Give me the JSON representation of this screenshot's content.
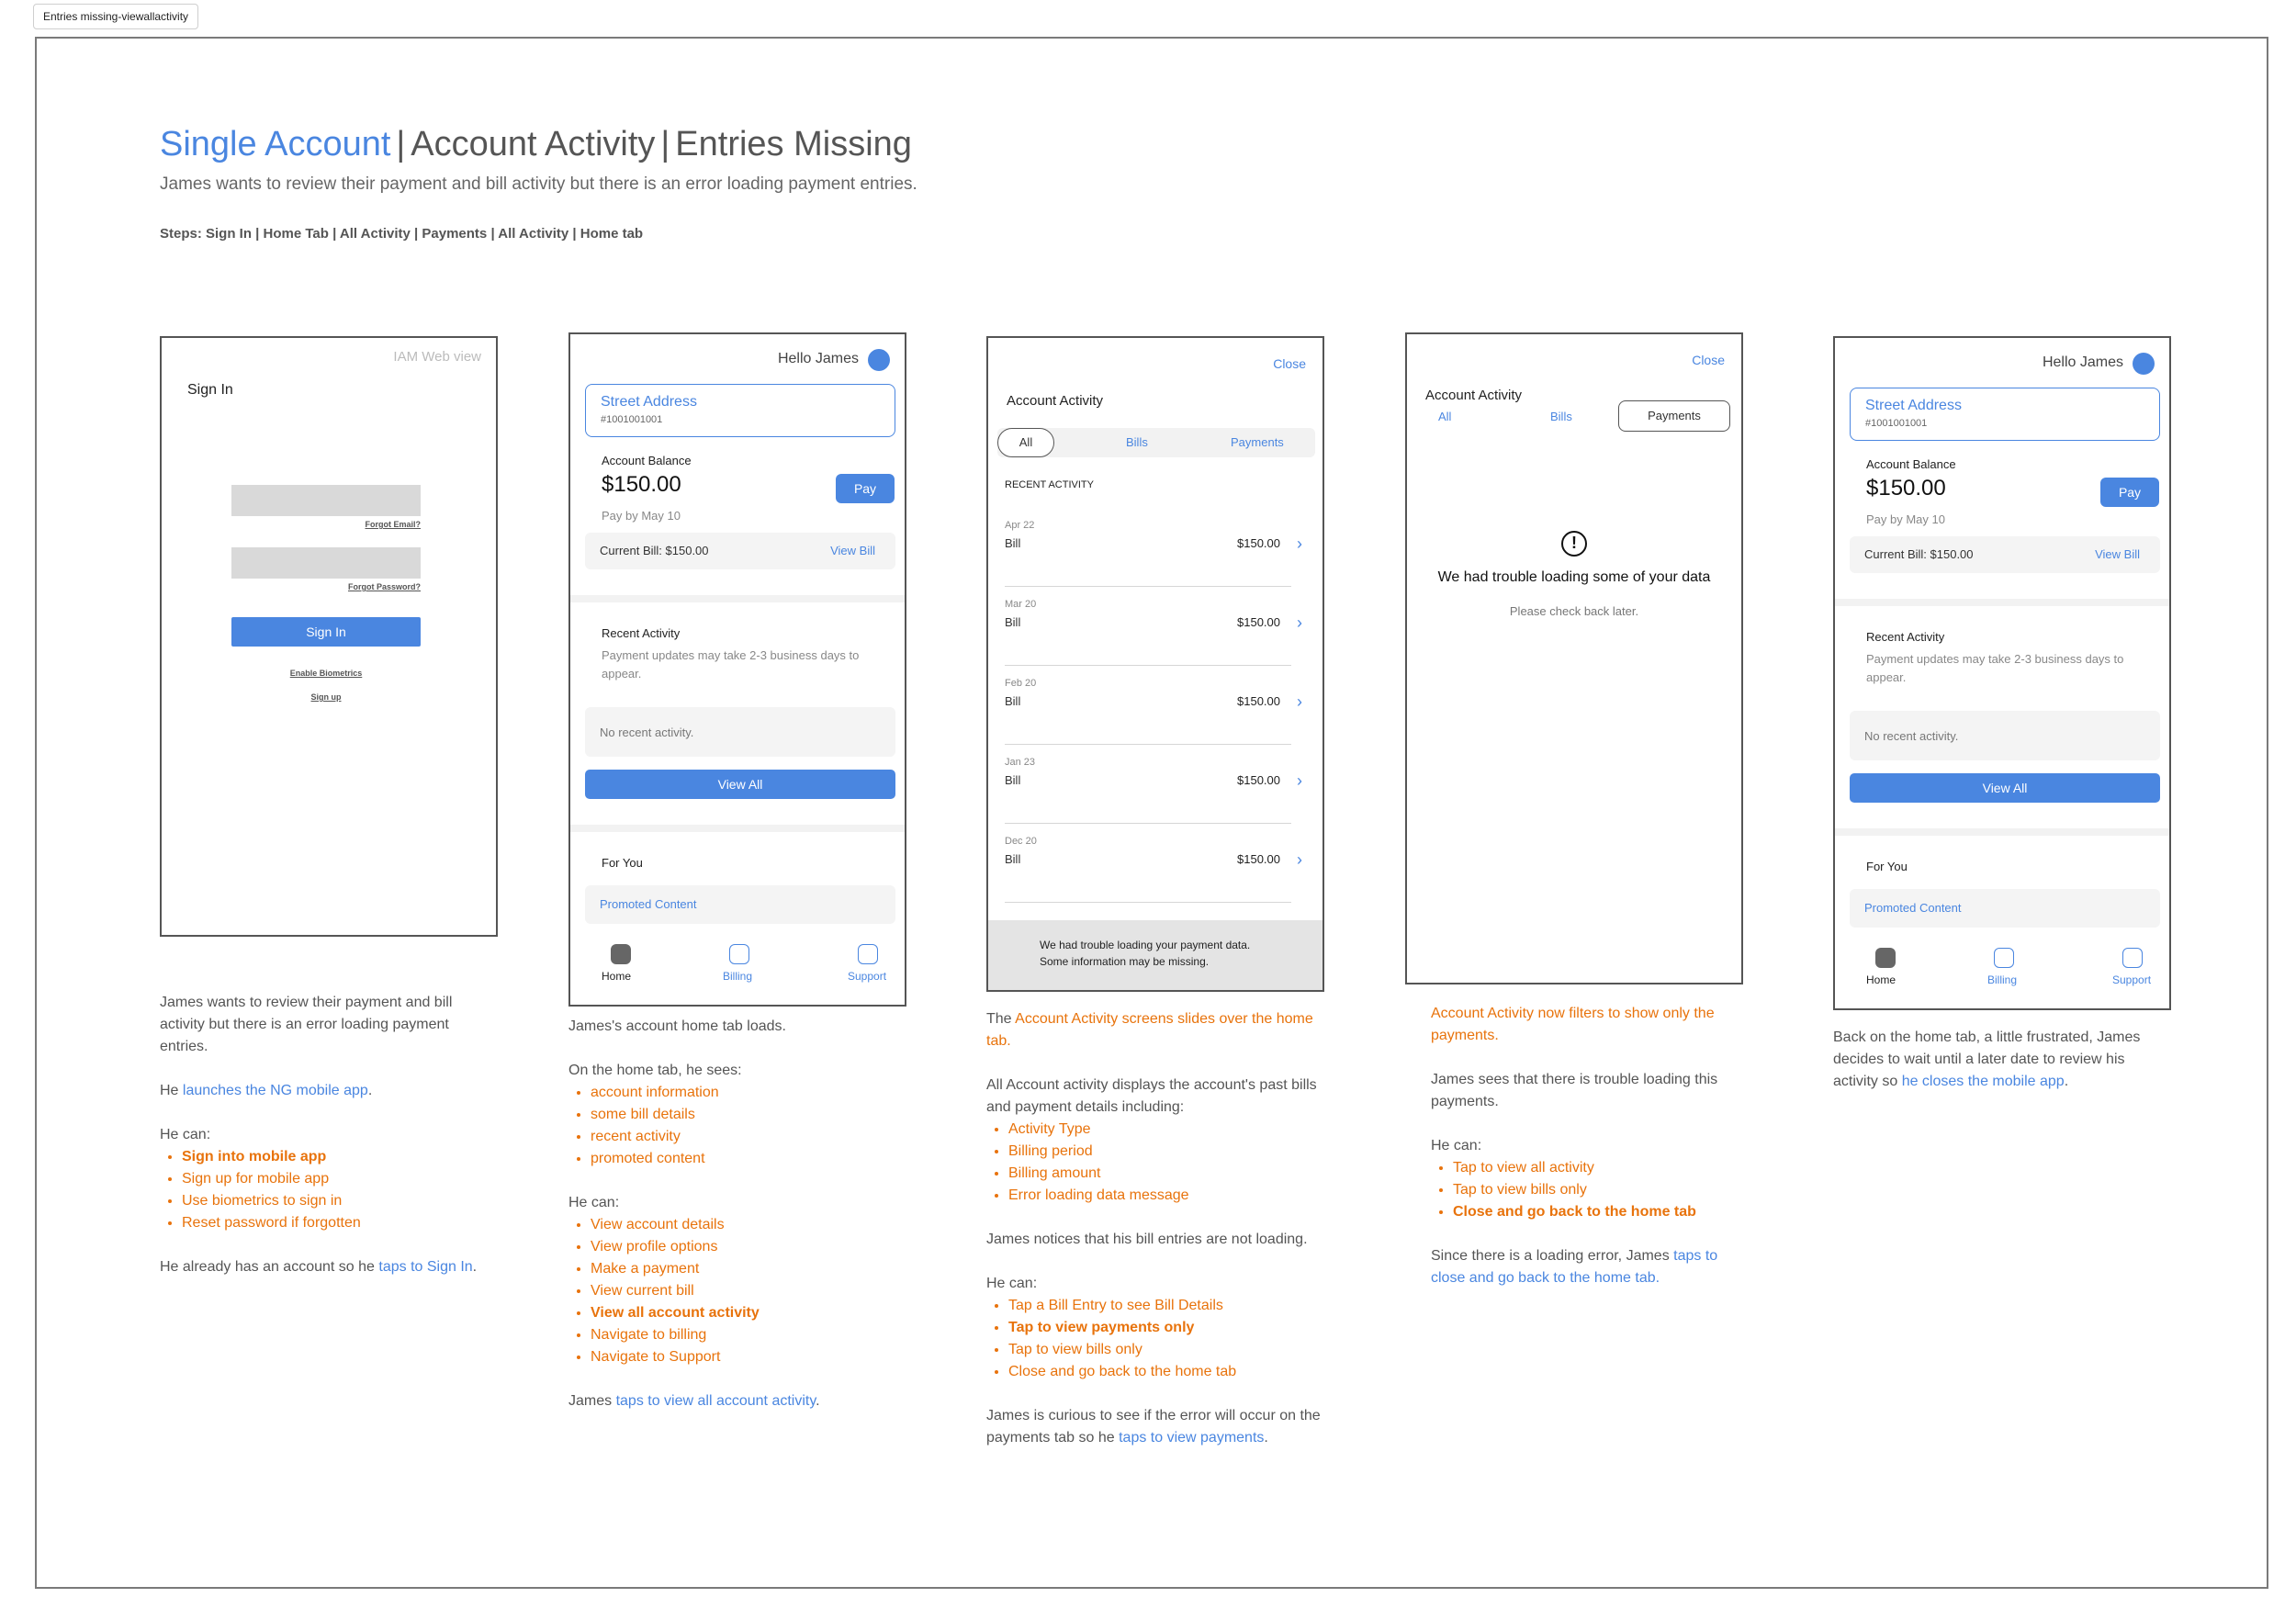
{
  "tag": "Entries missing-viewallactivity",
  "header": {
    "title_a": "Single Account",
    "title_b": "Account Activity",
    "title_c": "Entries Missing",
    "subtitle": "James wants to review their payment and bill activity but there is an error loading payment entries.",
    "steps": "Steps: Sign In | Home Tab |  All Activity | Payments  | All Activity | Home tab"
  },
  "signin": {
    "webview": "IAM Web view",
    "title": "Sign In",
    "forgot_email": "Forgot Email?",
    "forgot_password": "Forgot Password?",
    "button": "Sign In",
    "biometrics": "Enable Biometrics",
    "signup": "Sign up"
  },
  "home": {
    "greeting": "Hello James",
    "street": "Street Address",
    "account_no": "#1001001001",
    "balance_label": "Account Balance",
    "balance": "$150.00",
    "pay": "Pay",
    "pay_by": "Pay by May 10",
    "current_bill": "Current Bill: $150.00",
    "view_bill": "View Bill",
    "recent_title": "Recent Activity",
    "recent_note": "Payment updates may take 2-3 business days to appear.",
    "no_recent": "No recent activity.",
    "view_all": "View All",
    "for_you": "For You",
    "promoted": "Promoted Content",
    "nav_home": "Home",
    "nav_billing": "Billing",
    "nav_support": "Support"
  },
  "activity": {
    "close": "Close",
    "title": "Account Activity",
    "tab_all": "All",
    "tab_bills": "Bills",
    "tab_payments": "Payments",
    "recent": "RECENT ACTIVITY",
    "rows": [
      {
        "date": "Apr 22",
        "type": "Bill",
        "amount": "$150.00"
      },
      {
        "date": "Mar 20",
        "type": "Bill",
        "amount": "$150.00"
      },
      {
        "date": "Feb 20",
        "type": "Bill",
        "amount": "$150.00"
      },
      {
        "date": "Jan 23",
        "type": "Bill",
        "amount": "$150.00"
      },
      {
        "date": "Dec 20",
        "type": "Bill",
        "amount": "$150.00"
      }
    ],
    "banner_line1": "We had trouble loading your payment data.",
    "banner_line2": "Some information may be missing."
  },
  "payments_view": {
    "error_title": "We had trouble loading some of your data",
    "error_sub": "Please check back later."
  },
  "desc1": {
    "p1": "James wants to review their payment and bill activity but there is an error loading payment entries.",
    "p2a": "He ",
    "p2b": "launches the NG mobile app",
    "p2c": ".",
    "can": "He can:",
    "items": [
      "Sign into mobile app",
      "Sign up for mobile app",
      "Use biometrics to sign in",
      "Reset password if forgotten"
    ],
    "p3a": "He already has an account so he ",
    "p3b": "taps to Sign In",
    "p3c": "."
  },
  "desc2": {
    "p1": "James's account home tab loads.",
    "sees": "On the home tab, he sees:",
    "sees_items": [
      "account information",
      "some bill details",
      "recent activity",
      "promoted content"
    ],
    "can": "He can:",
    "items": [
      "View account details",
      "View profile options",
      "Make a payment",
      "View current bill",
      "View all account activity",
      "Navigate to billing",
      "Navigate to Support"
    ],
    "p3a": "James ",
    "p3b": "taps to view all account activity",
    "p3c": "."
  },
  "desc3": {
    "p1a": "The ",
    "p1b": "Account Activity screens slides over the home tab.",
    "p2": "All Account activity displays the account's past bills and payment details including:",
    "list": [
      "Activity Type",
      "Billing period",
      "Billing amount",
      "Error loading data message"
    ],
    "p3": "James notices that his bill entries are not loading.",
    "can": "He can:",
    "items": [
      "Tap a Bill Entry to see Bill Details",
      "Tap to view payments only",
      "Tap to view bills only",
      "Close and go back to the home tab"
    ],
    "p4a": "James is curious to see if the error will occur on the payments tab so he ",
    "p4b": "taps to view payments",
    "p4c": "."
  },
  "desc4": {
    "p1": "Account Activity now filters to show only the payments.",
    "p2": "James sees that there is trouble loading this payments.",
    "can": "He can:",
    "items": [
      "Tap to view all activity",
      "Tap to view bills only",
      "Close and go back to the home tab"
    ],
    "p3a": "Since there is a loading error, James ",
    "p3b": "taps to close and go back to the home tab."
  },
  "desc5": {
    "p1a": "Back on the home tab, a little frustrated, James decides to wait until a later date to review his activity so ",
    "p1b": "he closes the mobile app",
    "p1c": "."
  },
  "colors": {
    "accent": "#4a86e0",
    "highlight": "#e8730c"
  }
}
